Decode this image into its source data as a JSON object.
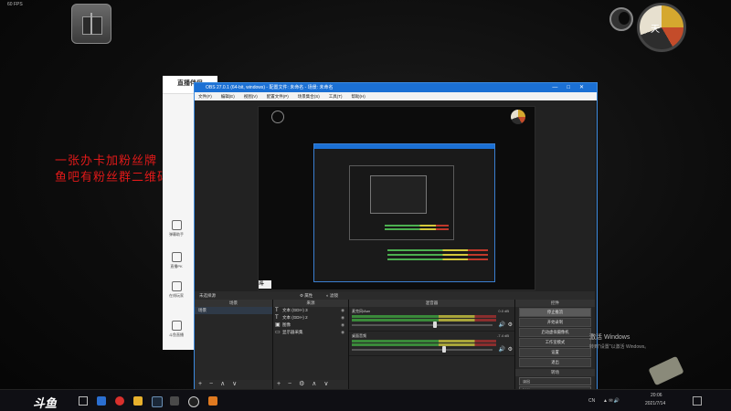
{
  "overlay": {
    "fps": "60 FPS",
    "clock_char": "天",
    "danmu": [
      "一张办卡加粉丝牌",
      "鱼吧有粉丝群二维码"
    ]
  },
  "douyu_panel": {
    "title": "直播伴侣",
    "items": [
      "弹幕助手",
      "直播PK",
      "在线玩家",
      "斗鱼直播"
    ]
  },
  "obs": {
    "title": "OBS 27.0.1 (64-bit, windows) - 配置文件: 未命名 - 场景: 未命名",
    "window_buttons": [
      "—",
      "□",
      "✕"
    ],
    "menu": [
      "文件(F)",
      "编辑(E)",
      "视图(V)",
      "配置文件(P)",
      "场景集合(S)",
      "工具(T)",
      "帮助(H)"
    ],
    "context_bar": {
      "no_source": "未选择源",
      "properties": "属性",
      "filters": "滤镜"
    },
    "docks": {
      "scenes": {
        "header": "场景",
        "items": [
          "场景"
        ],
        "footer": "+ − ∧ ∨"
      },
      "sources": {
        "header": "来源",
        "footer": "+ − ⚙ ∧ ∨",
        "items": [
          {
            "icon": "text-icon",
            "label": "文本 (GDI+) 3"
          },
          {
            "icon": "text-icon",
            "label": "文本 (GDI+) 2"
          },
          {
            "icon": "image-icon",
            "label": "图像"
          },
          {
            "icon": "display-capture-icon",
            "label": "显示器采集"
          }
        ]
      },
      "mixer": {
        "header": "混音器",
        "channels": [
          {
            "name": "麦克风/Aux",
            "db": "0.0 dB",
            "fader": 0.55
          },
          {
            "name": "桌面音频",
            "db": "-7.4 dB",
            "fader": 0.45
          }
        ]
      },
      "transitions": {
        "header": "转场",
        "type": "淡出",
        "duration_label": "时长",
        "duration": "300 ms"
      },
      "controls": {
        "header": "控件",
        "buttons": [
          "停止推流",
          "开始录制",
          "启动虚拟摄像机",
          "工作室模式",
          "设置",
          "退出"
        ]
      }
    },
    "status": {
      "live": "LIVE: 00:00:00",
      "rec": "REC: 00:00:00",
      "cpu": "CPU: 4.9%, 60.00 fps",
      "kbps": "延迟 0 帧 (0.0%) 0 kb/s"
    }
  },
  "desktop": {
    "activate": [
      "激活 Windows",
      "转到\"设置\"以激活 Windows。"
    ],
    "taskbar": {
      "logo": "斗鱼",
      "lang": "CN",
      "time": "20:06",
      "date": "2021/7/14"
    }
  }
}
